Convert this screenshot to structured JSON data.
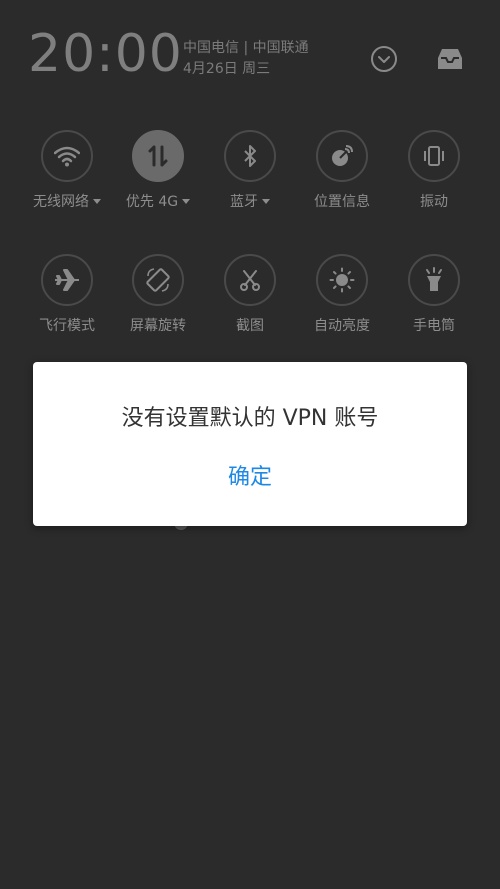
{
  "status": {
    "time": "20:00",
    "carriers": "中国电信 | 中国联通",
    "date": "4月26日 周三"
  },
  "header_icons": {
    "expand": "chevron-down-circle-icon",
    "inbox": "inbox-tray-icon"
  },
  "toggles": [
    {
      "label": "无线网络",
      "icon": "wifi-icon",
      "caret": true,
      "active": false
    },
    {
      "label": "优先 4G",
      "icon": "mobile-data-icon",
      "caret": true,
      "active": true
    },
    {
      "label": "蓝牙",
      "icon": "bluetooth-icon",
      "caret": true,
      "active": false
    },
    {
      "label": "位置信息",
      "icon": "location-icon",
      "caret": false,
      "active": false
    },
    {
      "label": "振动",
      "icon": "vibrate-icon",
      "caret": false,
      "active": false
    },
    {
      "label": "飞行模式",
      "icon": "airplane-icon",
      "caret": false,
      "active": false
    },
    {
      "label": "屏幕旋转",
      "icon": "rotate-screen-icon",
      "caret": false,
      "active": false
    },
    {
      "label": "截图",
      "icon": "scissors-icon",
      "caret": false,
      "active": false
    },
    {
      "label": "自动亮度",
      "icon": "brightness-icon",
      "caret": false,
      "active": false
    },
    {
      "label": "手电筒",
      "icon": "flashlight-icon",
      "caret": false,
      "active": false
    }
  ],
  "dialog": {
    "message": "没有设置默认的 VPN 账号",
    "confirm_label": "确定"
  },
  "colors": {
    "background": "#2b2b2b",
    "dialog_bg": "#ffffff",
    "accent": "#1e88e5",
    "icon_gray": "#8a8a8a"
  }
}
